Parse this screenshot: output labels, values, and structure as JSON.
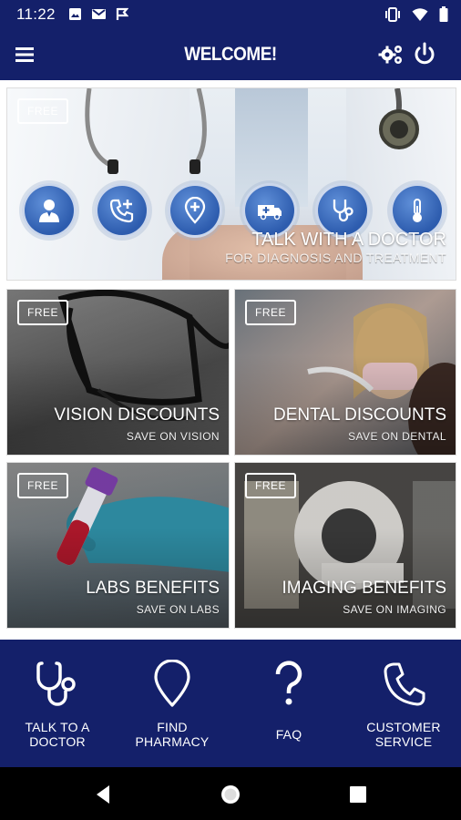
{
  "status_bar": {
    "time": "11:22"
  },
  "app_bar": {
    "title": "WELCOME!"
  },
  "hero": {
    "badge": "FREE",
    "title": "TALK WITH A DOCTOR",
    "subtitle": "FOR DIAGNOSIS AND TREATMENT",
    "service_icons": [
      "doctor-icon",
      "phone-plus-icon",
      "location-plus-icon",
      "ambulance-icon",
      "stethoscope-icon",
      "thermometer-icon"
    ]
  },
  "tiles": [
    {
      "badge": "FREE",
      "title": "VISION DISCOUNTS",
      "subtitle": "SAVE ON VISION"
    },
    {
      "badge": "FREE",
      "title": "DENTAL DISCOUNTS",
      "subtitle": "SAVE ON DENTAL"
    },
    {
      "badge": "FREE",
      "title": "LABS BENEFITS",
      "subtitle": "SAVE ON LABS"
    },
    {
      "badge": "FREE",
      "title": "IMAGING BENEFITS",
      "subtitle": "SAVE ON IMAGING"
    }
  ],
  "bottom_nav": [
    {
      "line1": "TALK TO A",
      "line2": "DOCTOR",
      "icon": "stethoscope-icon"
    },
    {
      "line1": "FIND",
      "line2": "PHARMACY",
      "icon": "map-pin-icon"
    },
    {
      "line1": "FAQ",
      "line2": "",
      "icon": "question-mark-icon"
    },
    {
      "line1": "CUSTOMER",
      "line2": "SERVICE",
      "icon": "phone-icon"
    }
  ],
  "colors": {
    "primary": "#14206a",
    "accent": "#2d5cae",
    "text": "#ffffff"
  }
}
